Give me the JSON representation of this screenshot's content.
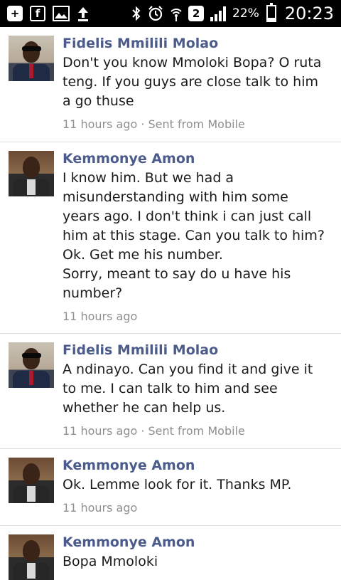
{
  "status_bar": {
    "icons": [
      "add-icon",
      "facebook-icon",
      "gallery-icon",
      "upload-icon",
      "bluetooth-icon",
      "alarm-icon",
      "wifi-icon",
      "sim-icon",
      "signal-icon"
    ],
    "sim_label": "2",
    "battery": "22%",
    "battery_level": 0.22,
    "time": "20:23"
  },
  "messages": [
    {
      "sender": "Fidelis Mmilili Molao",
      "text": "Don't you know Mmoloki Bopa? O ruta teng. If you guys are close talk to him a go thuse",
      "meta": "11 hours ago · Sent from Mobile"
    },
    {
      "sender": "Kemmonye Amon",
      "text": "I know him. But we had a misunderstanding with him some years ago. I don't think i can just call him at this stage. Can you talk to him?\nOk. Get me his number.\nSorry, meant to say do u have his number?",
      "meta": "11 hours ago"
    },
    {
      "sender": "Fidelis Mmilili Molao",
      "text": "A ndinayo. Can you find it and give it to me. I can talk to him and see whether he can help us.",
      "meta": "11 hours ago · Sent from Mobile"
    },
    {
      "sender": "Kemmonye Amon",
      "text": "Ok. Lemme look for it. Thanks MP.",
      "meta": "11 hours ago"
    },
    {
      "sender": "Kemmonye Amon",
      "text": "Bopa Mmoloki",
      "meta": ""
    }
  ]
}
